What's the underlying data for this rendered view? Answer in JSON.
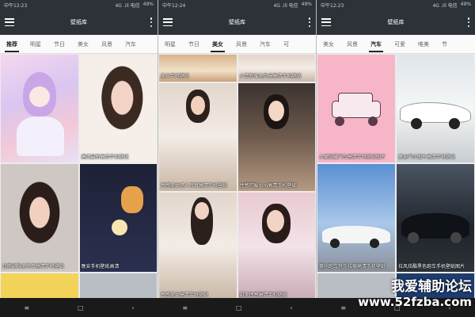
{
  "phones": [
    {
      "status": {
        "time": "中午12:23",
        "carrier": "4G .ill 电信",
        "battery": "49%"
      },
      "title": "壁纸库",
      "tabs": [
        "推荐",
        "明星",
        "节日",
        "美女",
        "风景",
        "汽车"
      ],
      "active_tab": 0,
      "cards": [
        {
          "caption": ""
        },
        {
          "caption": "唐嫣最新高清手机壁纸"
        },
        {
          "caption": "赵丽颖唯美写真高清手机壁纸"
        },
        {
          "caption": "晚安手机壁纸高清"
        }
      ]
    },
    {
      "status": {
        "time": "中午12:24",
        "carrier": "4G .ill 电信",
        "battery": "49%"
      },
      "title": "壁纸库",
      "tabs": [
        "明星",
        "节日",
        "美女",
        "风景",
        "汽车",
        "可"
      ],
      "active_tab": 2,
      "cards": [
        {
          "caption": "美女手机壁纸"
        },
        {
          "caption": "小清新唯美风景高清手机壁纸"
        },
        {
          "caption": "性感美女诱人写真高清手机壁纸"
        },
        {
          "caption": "性感可爱mm高清手机壁纸"
        },
        {
          "caption": "性感美女高清手机壁纸"
        },
        {
          "caption": "甜美性感高清手机壁纸"
        }
      ]
    },
    {
      "status": {
        "time": "中午12:23",
        "carrier": "4G .ill 电信",
        "battery": "49%"
      },
      "title": "壁纸库",
      "tabs": [
        "美女",
        "风景",
        "汽车",
        "可爱",
        "唯美",
        "节"
      ],
      "active_tab": 2,
      "cards": [
        {
          "caption": "大量隐藏汽车高清手机壁纸图片"
        },
        {
          "caption": "奥迪汽车图片高清手机壁纸"
        },
        {
          "caption": "豪华跑车玛莎拉蒂高清手机壁纸"
        },
        {
          "caption": "拉风炫酷黑色跑车手机壁纸图片"
        }
      ]
    }
  ],
  "nav_buttons": [
    "≡",
    "□",
    "‹"
  ],
  "watermark": {
    "line1": "我爱辅助论坛",
    "line2": "www.52fzba.com"
  }
}
